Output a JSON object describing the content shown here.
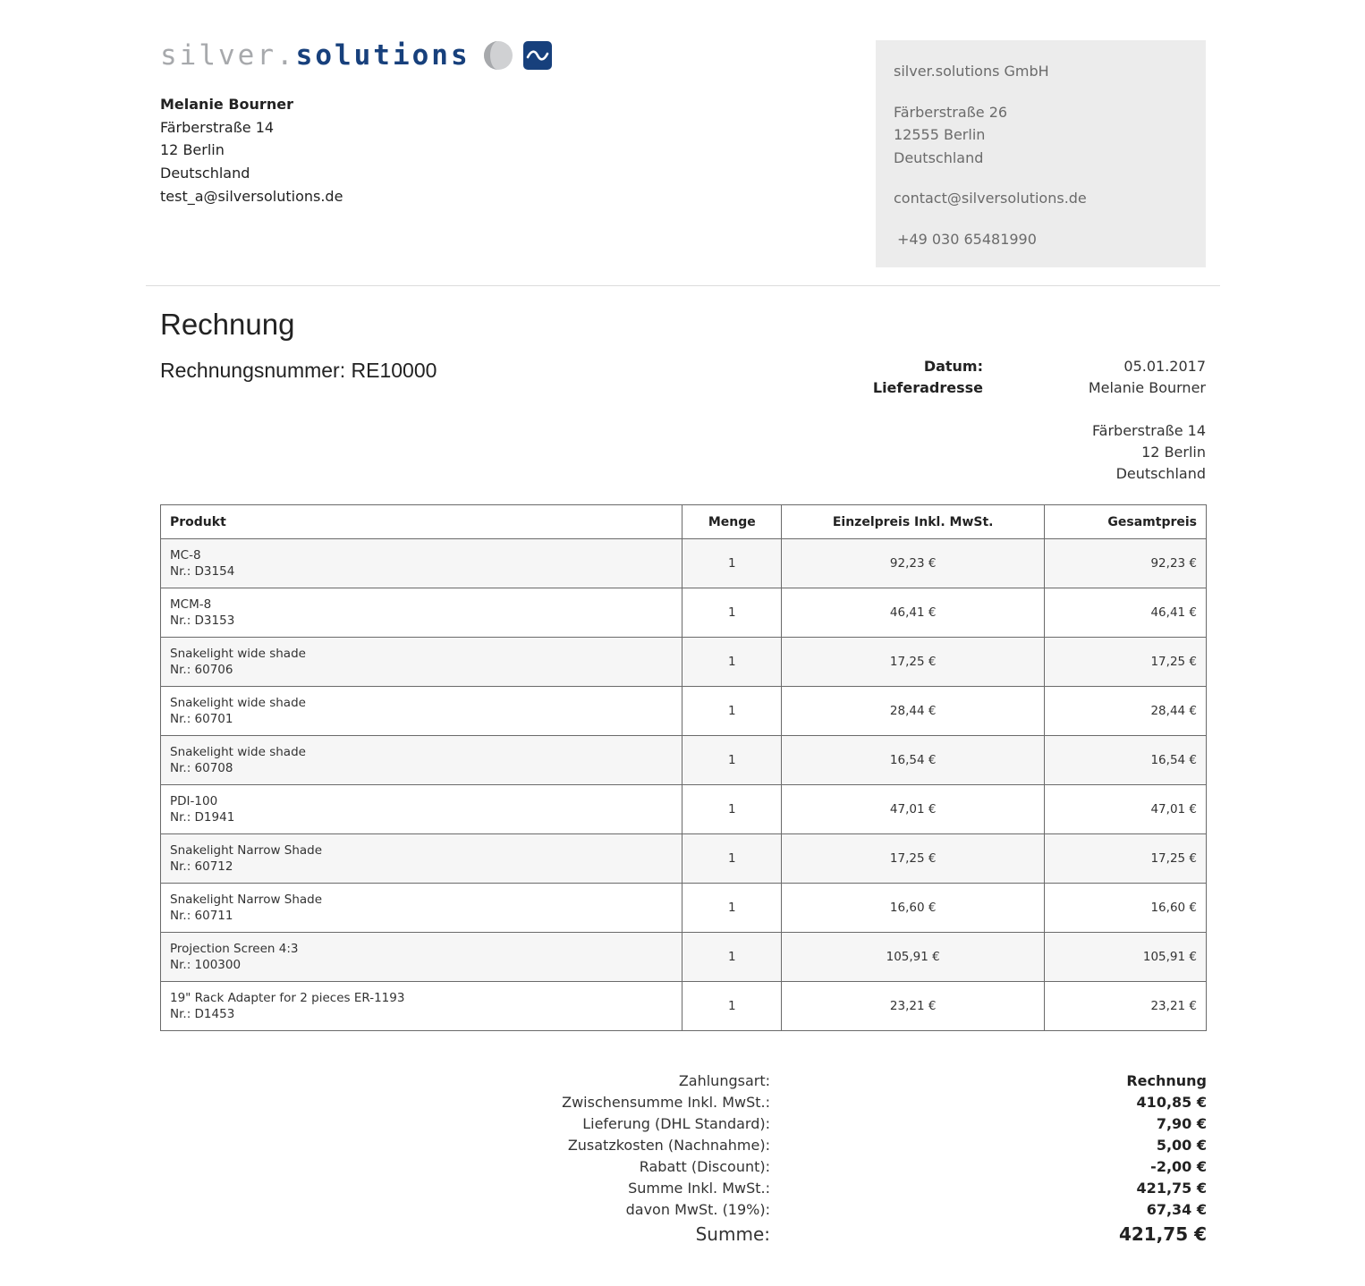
{
  "header": {
    "logo_silver": "silver.",
    "logo_solutions": "solutions",
    "colors": {
      "logo_grey": "#a7a9ac",
      "logo_blue": "#17407c"
    }
  },
  "customer": {
    "name": "Melanie Bourner",
    "street": "Färberstraße 14",
    "city": "12 Berlin",
    "country": "Deutschland",
    "email": "test_a@silversolutions.de"
  },
  "company": {
    "name": "silver.solutions GmbH",
    "street": "Färberstraße 26",
    "city": "12555 Berlin",
    "country": "Deutschland",
    "email": "contact@silversolutions.de",
    "phone": "+49 030 65481990"
  },
  "invoice": {
    "title": "Rechnung",
    "number": "Rechnungsnummer: RE10000",
    "date_label": "Datum:",
    "date": "05.01.2017",
    "delivery_label": "Lieferadresse",
    "delivery": {
      "name": "Melanie Bourner",
      "street": "Färberstraße 14",
      "city": "12 Berlin",
      "country": "Deutschland"
    }
  },
  "table": {
    "headers": {
      "product": "Produkt",
      "quantity": "Menge",
      "unit_price": "Einzelpreis Inkl. MwSt.",
      "total": "Gesamtpreis"
    },
    "rows": [
      {
        "name": "MC-8",
        "nr": "Nr.: D3154",
        "qty": "1",
        "unit": "92,23 €",
        "total": "92,23 €"
      },
      {
        "name": "MCM-8",
        "nr": "Nr.: D3153",
        "qty": "1",
        "unit": "46,41 €",
        "total": "46,41 €"
      },
      {
        "name": "Snakelight wide shade",
        "nr": "Nr.: 60706",
        "qty": "1",
        "unit": "17,25 €",
        "total": "17,25 €"
      },
      {
        "name": "Snakelight wide shade",
        "nr": "Nr.: 60701",
        "qty": "1",
        "unit": "28,44 €",
        "total": "28,44 €"
      },
      {
        "name": "Snakelight wide shade",
        "nr": "Nr.: 60708",
        "qty": "1",
        "unit": "16,54 €",
        "total": "16,54 €"
      },
      {
        "name": "PDI-100",
        "nr": "Nr.: D1941",
        "qty": "1",
        "unit": "47,01 €",
        "total": "47,01 €"
      },
      {
        "name": "Snakelight Narrow Shade",
        "nr": "Nr.: 60712",
        "qty": "1",
        "unit": "17,25 €",
        "total": "17,25 €"
      },
      {
        "name": "Snakelight Narrow Shade",
        "nr": "Nr.: 60711",
        "qty": "1",
        "unit": "16,60 €",
        "total": "16,60 €"
      },
      {
        "name": "Projection Screen 4:3",
        "nr": "Nr.: 100300",
        "qty": "1",
        "unit": "105,91 €",
        "total": "105,91 €"
      },
      {
        "name": "19\" Rack Adapter for 2 pieces ER-1193",
        "nr": "Nr.: D1453",
        "qty": "1",
        "unit": "23,21 €",
        "total": "23,21 €"
      }
    ]
  },
  "totals": [
    {
      "label": "Zahlungsart:",
      "value": "Rechnung"
    },
    {
      "label": "Zwischensumme Inkl. MwSt.:",
      "value": "410,85 €"
    },
    {
      "label": "Lieferung (DHL Standard):",
      "value": "7,90 €"
    },
    {
      "label": "Zusatzkosten (Nachnahme):",
      "value": "5,00 €"
    },
    {
      "label": "Rabatt (Discount):",
      "value": "-2,00 €"
    },
    {
      "label": "Summe Inkl. MwSt.:",
      "value": "421,75 €"
    },
    {
      "label": "davon MwSt. (19%):",
      "value": "67,34 €"
    },
    {
      "label": "Summe:",
      "value": "421,75 €"
    }
  ]
}
